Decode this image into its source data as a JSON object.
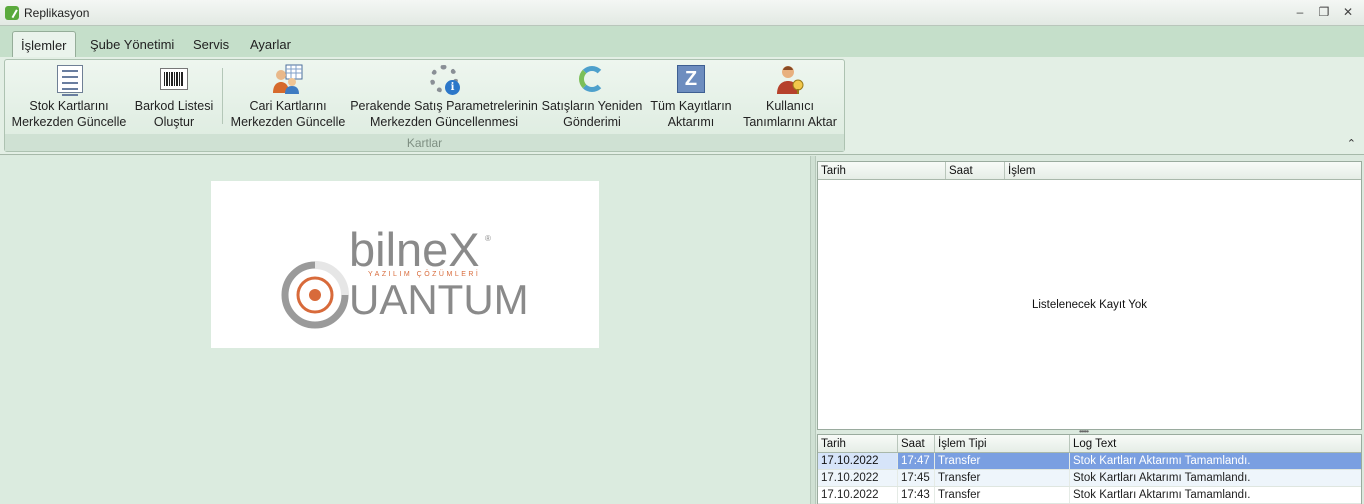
{
  "window": {
    "title": "Replikasyon"
  },
  "tabs": [
    {
      "label": "İşlemler",
      "active": true
    },
    {
      "label": "Şube Yönetimi"
    },
    {
      "label": "Servis"
    },
    {
      "label": "Ayarlar"
    }
  ],
  "ribbon": {
    "group_caption": "Kartlar",
    "buttons": [
      {
        "line1": "Stok Kartlarını",
        "line2": "Merkezden Güncelle",
        "icon": "document-list-icon"
      },
      {
        "line1": "Barkod Listesi",
        "line2": "Oluştur",
        "icon": "barcode-icon"
      },
      {
        "line1": "Cari Kartlarını",
        "line2": "Merkezden Güncelle",
        "icon": "users-grid-icon"
      },
      {
        "line1": "Perakende Satış Parametrelerinin",
        "line2": "Merkezden Güncellenmesi",
        "icon": "gear-info-icon"
      },
      {
        "line1": "Satışların Yeniden",
        "line2": "Gönderimi",
        "icon": "sync-icon"
      },
      {
        "line1": "Tüm Kayıtların",
        "line2": "Aktarımı",
        "icon": "transfer-icon"
      },
      {
        "line1": "Kullanıcı",
        "line2": "Tanımlarını Aktar",
        "icon": "user-key-icon"
      }
    ]
  },
  "logo": {
    "brand": "bilneX",
    "tagline": "YAZILIM ÇÖZÜMLERİ",
    "product": "UANTUM",
    "registered": "®"
  },
  "grid_top": {
    "columns": [
      "Tarih",
      "Saat",
      "İşlem"
    ],
    "empty_message": "Listelenecek Kayıt Yok"
  },
  "grid_log": {
    "columns": [
      "Tarih",
      "Saat",
      "İşlem Tipi",
      "Log Text"
    ],
    "rows": [
      {
        "date": "17.10.2022",
        "time": "17:47",
        "type": "Transfer",
        "text": "Stok Kartları Aktarımı Tamamlandı."
      },
      {
        "date": "17.10.2022",
        "time": "17:45",
        "type": "Transfer",
        "text": "Stok Kartları Aktarımı Tamamlandı."
      },
      {
        "date": "17.10.2022",
        "time": "17:43",
        "type": "Transfer",
        "text": "Stok Kartları Aktarımı Tamamlandı."
      }
    ]
  },
  "colors": {
    "accent": "#c8dfcc",
    "selection": "#7a9fe1",
    "logo_orange": "#d86a3a",
    "logo_gray": "#8a8a8a"
  }
}
